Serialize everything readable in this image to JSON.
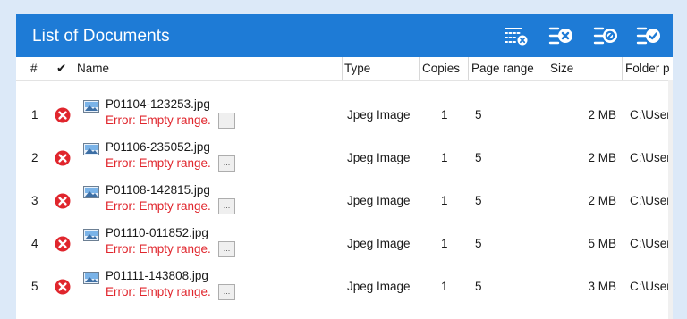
{
  "window": {
    "title": "List of Documents",
    "toolbar": [
      {
        "name": "remove-selected-icon"
      },
      {
        "name": "remove-all-icon"
      },
      {
        "name": "remove-errors-icon"
      },
      {
        "name": "remove-completed-icon"
      }
    ]
  },
  "table": {
    "columns": {
      "num": "#",
      "status": "✔",
      "name": "Name",
      "type": "Type",
      "copies": "Copies",
      "range": "Page range",
      "size": "Size",
      "folder": "Folder p"
    },
    "rows": [
      {
        "num": "1",
        "name": "P01104-123253.jpg",
        "error": "Error: Empty range.",
        "more": "...",
        "type": "Jpeg Image",
        "copies": "1",
        "range": "5",
        "size": "2 MB",
        "folder": "C:\\User"
      },
      {
        "num": "2",
        "name": "P01106-235052.jpg",
        "error": "Error: Empty range.",
        "more": "...",
        "type": "Jpeg Image",
        "copies": "1",
        "range": "5",
        "size": "2 MB",
        "folder": "C:\\User"
      },
      {
        "num": "3",
        "name": "P01108-142815.jpg",
        "error": "Error: Empty range.",
        "more": "...",
        "type": "Jpeg Image",
        "copies": "1",
        "range": "5",
        "size": "2 MB",
        "folder": "C:\\User"
      },
      {
        "num": "4",
        "name": "P01110-011852.jpg",
        "error": "Error: Empty range.",
        "more": "...",
        "type": "Jpeg Image",
        "copies": "1",
        "range": "5",
        "size": "5 MB",
        "folder": "C:\\User"
      },
      {
        "num": "5",
        "name": "P01111-143808.jpg",
        "error": "Error: Empty range.",
        "more": "...",
        "type": "Jpeg Image",
        "copies": "1",
        "range": "5",
        "size": "3 MB",
        "folder": "C:\\User"
      }
    ]
  },
  "colors": {
    "titlebar": "#1e7bd6",
    "error": "#e0262d",
    "background": "#dce9f8"
  }
}
